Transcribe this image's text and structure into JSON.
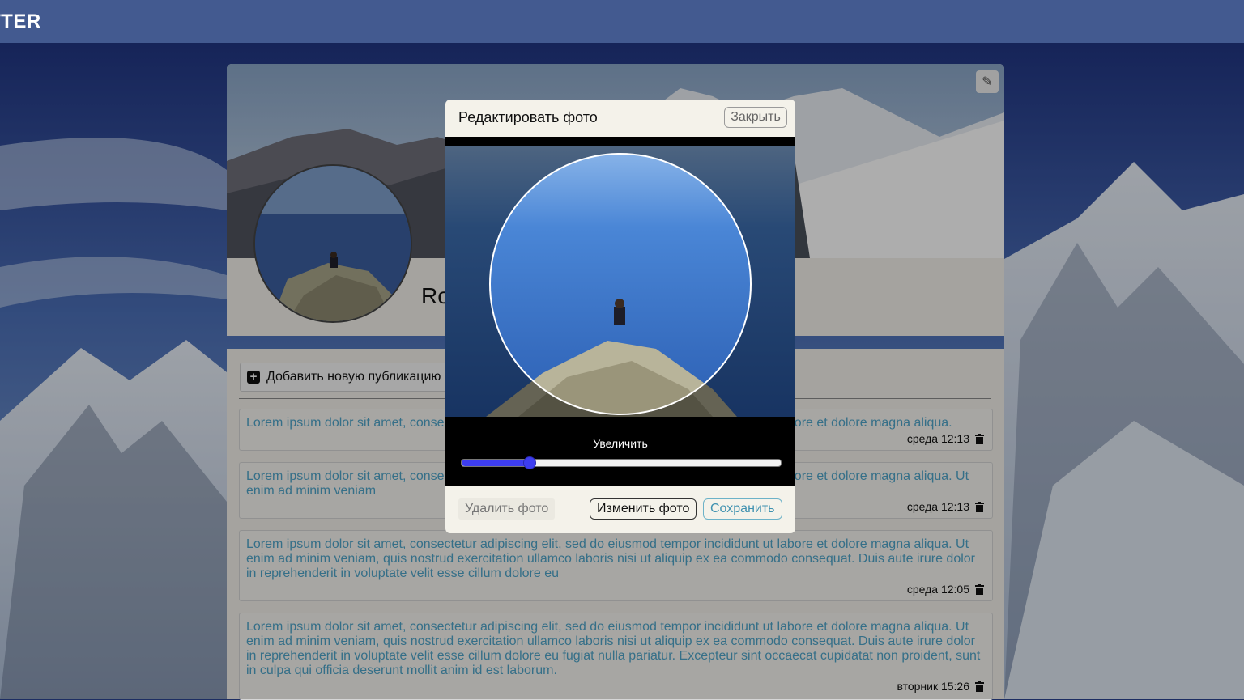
{
  "app": {
    "brand": "TTER"
  },
  "profile": {
    "username": "Ro"
  },
  "feed": {
    "add_post_label": "Добавить новую публикацию",
    "posts": [
      {
        "text": "Lorem ipsum dolor sit amet, consectetur adipiscing elit, sed do eiusmod tempor incididunt ut labore et dolore magna aliqua.",
        "time": "среда 12:13"
      },
      {
        "text": "Lorem ipsum dolor sit amet, consectetur adipiscing elit, sed do eiusmod tempor incididunt ut labore et dolore magna aliqua. Ut enim ad minim veniam",
        "time": "среда 12:13"
      },
      {
        "text": "Lorem ipsum dolor sit amet, consectetur adipiscing elit, sed do eiusmod tempor incididunt ut labore et dolore magna aliqua. Ut enim ad minim veniam, quis nostrud exercitation ullamco laboris nisi ut aliquip ex ea commodo consequat. Duis aute irure dolor in reprehenderit in voluptate velit esse cillum dolore eu",
        "time": "среда 12:05"
      },
      {
        "text": "Lorem ipsum dolor sit amet, consectetur adipiscing elit, sed do eiusmod tempor incididunt ut labore et dolore magna aliqua. Ut enim ad minim veniam, quis nostrud exercitation ullamco laboris nisi ut aliquip ex ea commodo consequat. Duis aute irure dolor in reprehenderit in voluptate velit esse cillum dolore eu fugiat nulla pariatur. Excepteur sint occaecat cupidatat non proident, sunt in culpa qui officia deserunt mollit anim id est laborum.",
        "time": "вторник 15:26"
      }
    ]
  },
  "modal": {
    "title": "Редактировать фото",
    "close_label": "Закрыть",
    "zoom_label": "Увеличить",
    "zoom_value": 0.21,
    "delete_label": "Удалить фото",
    "change_label": "Изменить фото",
    "save_label": "Сохранить"
  },
  "icons": {
    "edit": "pencil-icon",
    "add": "plus-icon",
    "delete": "trash-icon"
  },
  "colors": {
    "topbar": "#435a90",
    "link_text": "#4fa4c9",
    "slider": "#3d3df0"
  }
}
